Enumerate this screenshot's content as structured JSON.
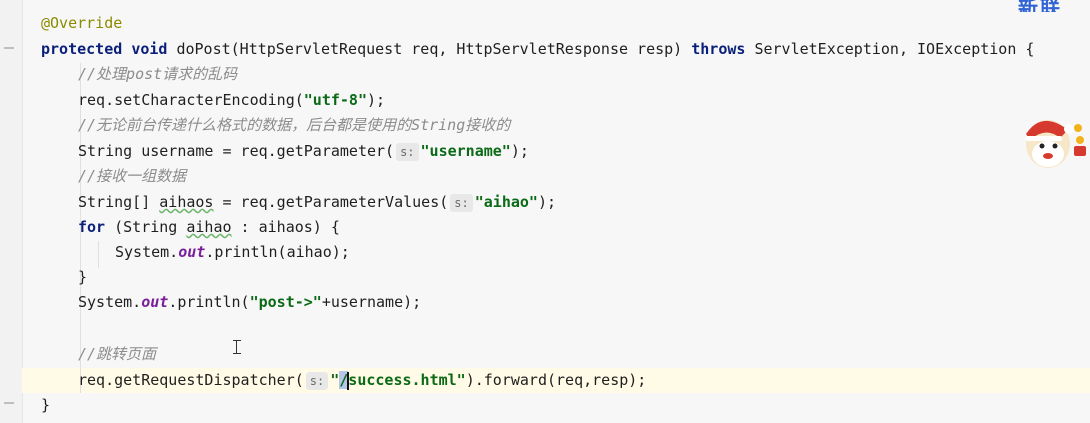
{
  "brand": {
    "text": "新联"
  },
  "code": {
    "annotation": "@Override",
    "sig_protected": "protected",
    "sig_void": "void",
    "sig_rest": " doPost(HttpServletRequest req, HttpServletResponse resp) ",
    "sig_throws": "throws",
    "sig_tail": " ServletException, IOException {",
    "c1": "//处理post请求的乱码",
    "l_enc_pre": "req.setCharacterEncoding(",
    "l_enc_str": "\"utf-8\"",
    "l_enc_post": ");",
    "c2": "//无论前台传递什么格式的数据，后台都是使用的String接收的",
    "l_user_pre": "String username = req.getParameter(",
    "hint_s": "s:",
    "l_user_str": "\"username\"",
    "l_user_post": ");",
    "c3": "//接收一组数据",
    "l_arr_pre": "String[] ",
    "l_arr_var": "aihaos",
    "l_arr_mid": " = req.getParameterValues(",
    "l_arr_str": "\"aihao\"",
    "l_arr_post": ");",
    "for_kw": "for",
    "for_pre": " (String ",
    "for_var": "aihao",
    "for_post": " : aihaos) {",
    "sys1_pre": "System.",
    "out": "out",
    "sys1_post": ".println(aihao);",
    "brace_close": "}",
    "sys2_pre": "System.",
    "sys2_mid": ".println(",
    "sys2_str": "\"post->\"",
    "sys2_post": "+username);",
    "c4": "//跳转页面",
    "fwd_pre": "req.getRequestDispatcher(",
    "fwd_q": "\"",
    "fwd_sel": "/",
    "fwd_str": "success.html\"",
    "fwd_post": ").forward(req,resp);",
    "method_close": "}"
  }
}
